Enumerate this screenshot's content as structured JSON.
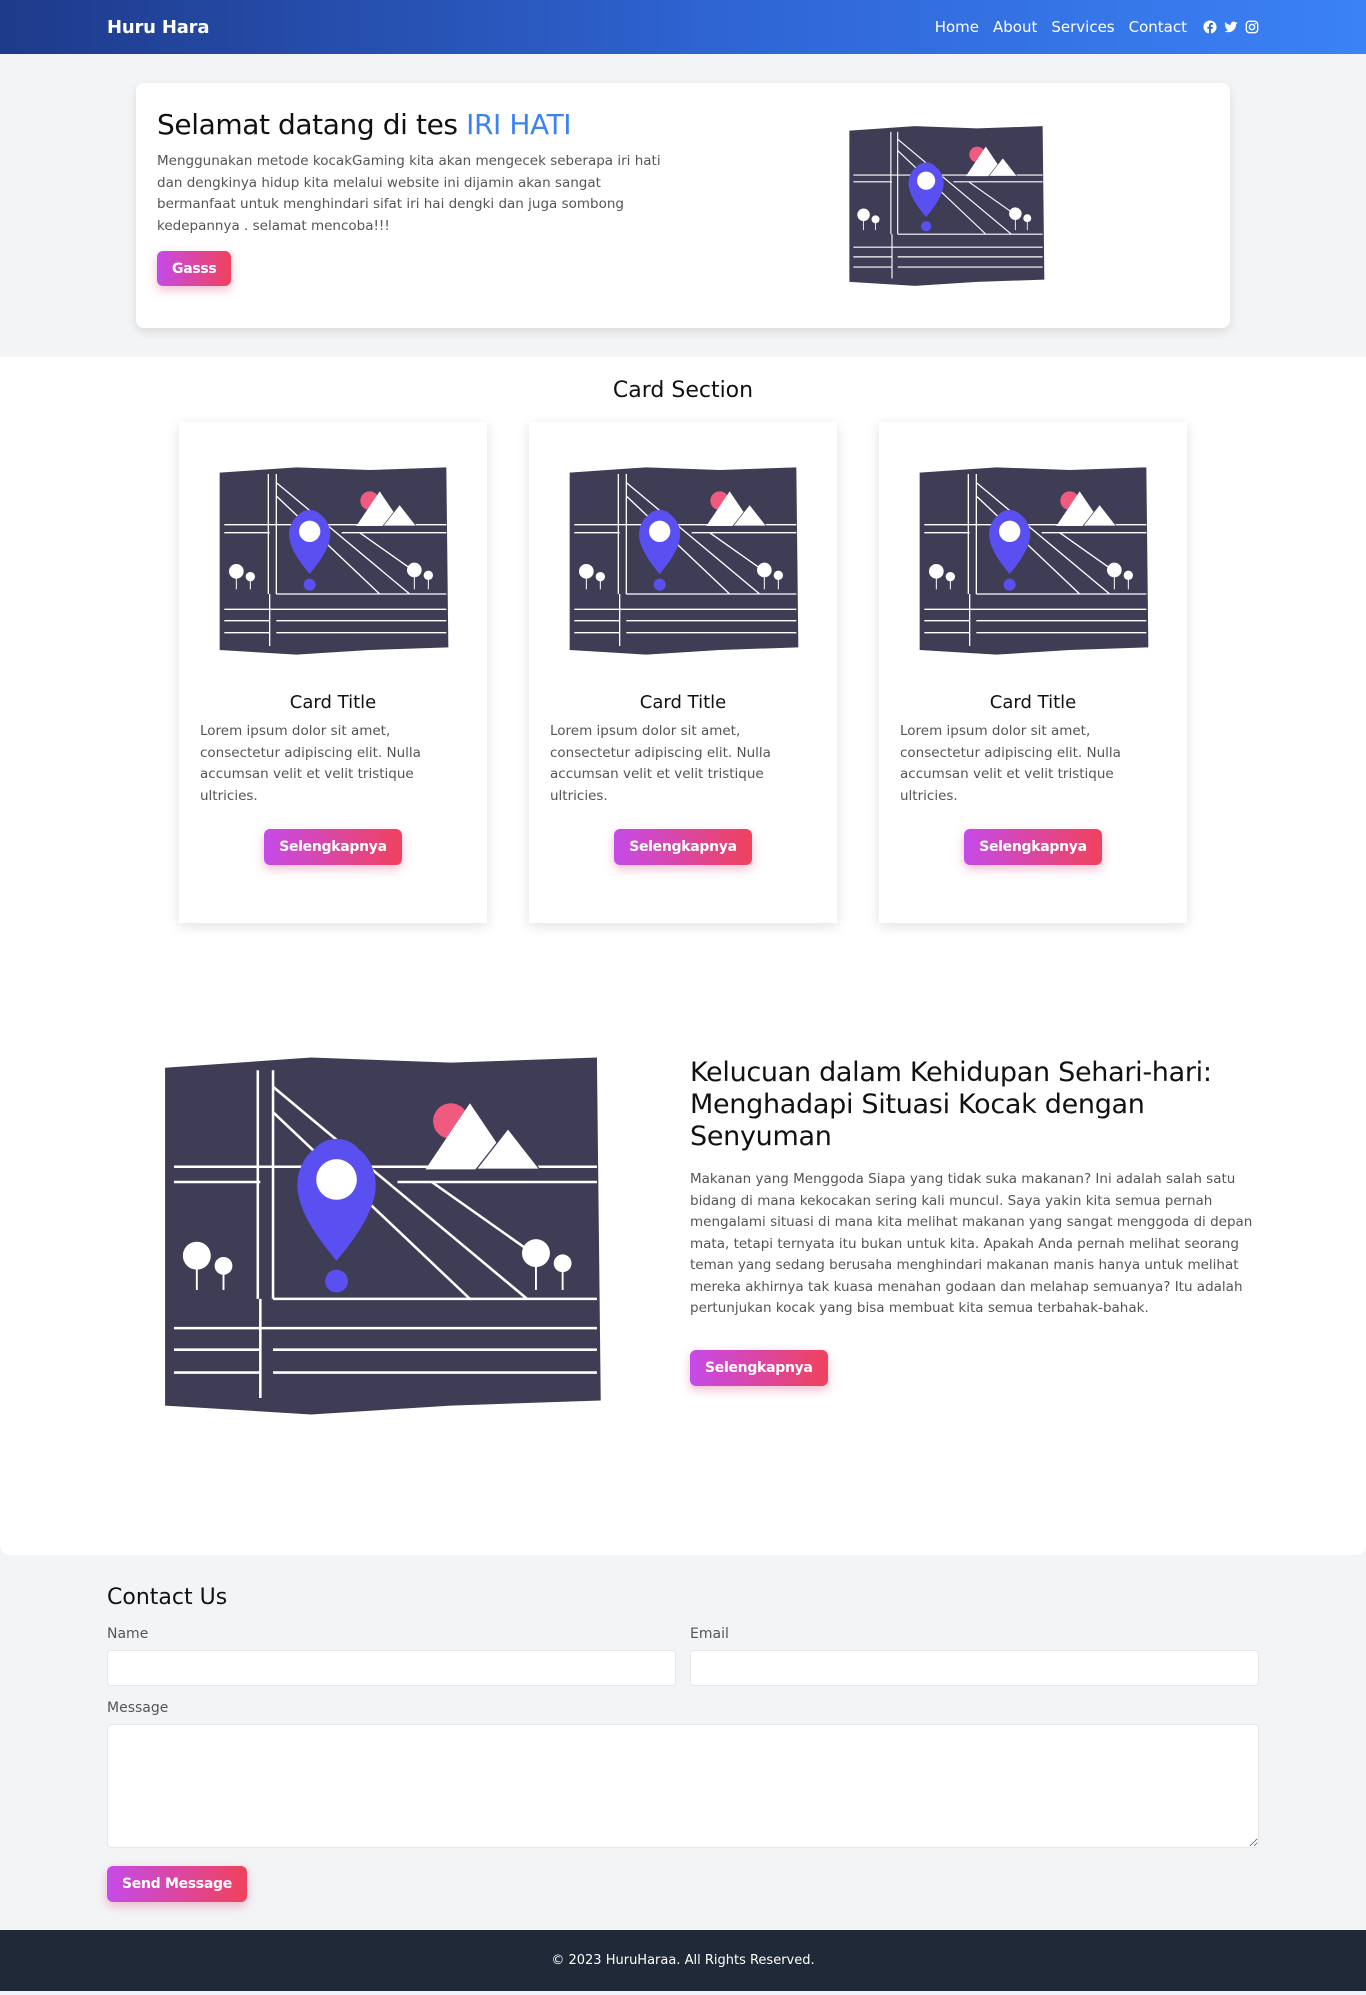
{
  "nav": {
    "brand": "Huru Hara",
    "links": [
      "Home",
      "About",
      "Services",
      "Contact"
    ],
    "social": [
      "facebook-icon",
      "twitter-icon",
      "instagram-icon"
    ]
  },
  "hero": {
    "title_prefix": "Selamat datang di tes ",
    "title_accent": "IRI HATI",
    "description": "Menggunakan metode kocakGaming kita akan mengecek seberapa iri hati dan dengkinya hidup kita melalui website ini dijamin akan sangat bermanfaat untuk menghindari sifat iri hai dengki dan juga sombong kedepannya . selamat mencoba!!!",
    "button": "Gasss"
  },
  "cards_section": {
    "title": "Card Section",
    "cards": [
      {
        "title": "Card Title",
        "text": "Lorem ipsum dolor sit amet, consectetur adipiscing elit. Nulla accumsan velit et velit tristique ultricies.",
        "button": "Selengkapnya"
      },
      {
        "title": "Card Title",
        "text": "Lorem ipsum dolor sit amet, consectetur adipiscing elit. Nulla accumsan velit et velit tristique ultricies.",
        "button": "Selengkapnya"
      },
      {
        "title": "Card Title",
        "text": "Lorem ipsum dolor sit amet, consectetur adipiscing elit. Nulla accumsan velit et velit tristique ultricies.",
        "button": "Selengkapnya"
      }
    ]
  },
  "feature": {
    "title": "Kelucuan dalam Kehidupan Sehari-hari: Menghadapi Situasi Kocak dengan Senyuman",
    "text": "Makanan yang Menggoda Siapa yang tidak suka makanan? Ini adalah salah satu bidang di mana kekocakan sering kali muncul. Saya yakin kita semua pernah mengalami situasi di mana kita melihat makanan yang sangat menggoda di depan mata, tetapi ternyata itu bukan untuk kita. Apakah Anda pernah melihat seorang teman yang sedang berusaha menghindari makanan manis hanya untuk melihat mereka akhirnya tak kuasa menahan godaan dan melahap semuanya? Itu adalah pertunjukan kocak yang bisa membuat kita semua terbahak-bahak.",
    "button": "Selengkapnya"
  },
  "contact": {
    "title": "Contact Us",
    "name_label": "Name",
    "email_label": "Email",
    "message_label": "Message",
    "name_value": "",
    "email_value": "",
    "message_value": "",
    "button": "Send Message"
  },
  "footer": {
    "text": "© 2023 HuruHaraa. All Rights Reserved."
  },
  "colors": {
    "accent": "#3b82f6",
    "button_gradient_start": "#c54ae8",
    "button_gradient_end": "#f0425c",
    "map_dark": "#3f3d56",
    "pin": "#5a4ff0",
    "sun": "#f05a7e",
    "footer_bg": "#1f2937"
  }
}
